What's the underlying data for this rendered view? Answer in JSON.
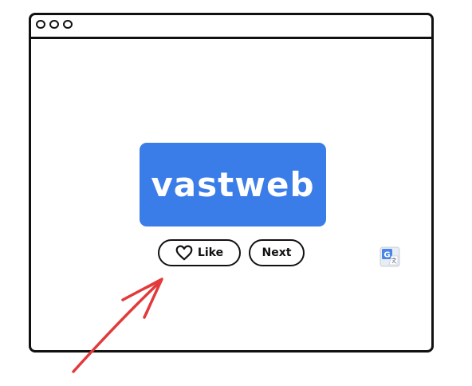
{
  "window": {
    "controls": [
      "circle",
      "circle",
      "circle"
    ]
  },
  "logo": {
    "text": "vastweb",
    "color": "#3b7de8"
  },
  "buttons": {
    "like_label": "Like",
    "next_label": "Next"
  },
  "icons": {
    "like": "heart-icon",
    "translate": "google-translate-icon",
    "pointer": "red-arrow-annotation"
  },
  "colors": {
    "outline": "#111111",
    "accent": "#3b7de8",
    "arrow": "#e23b3b"
  }
}
